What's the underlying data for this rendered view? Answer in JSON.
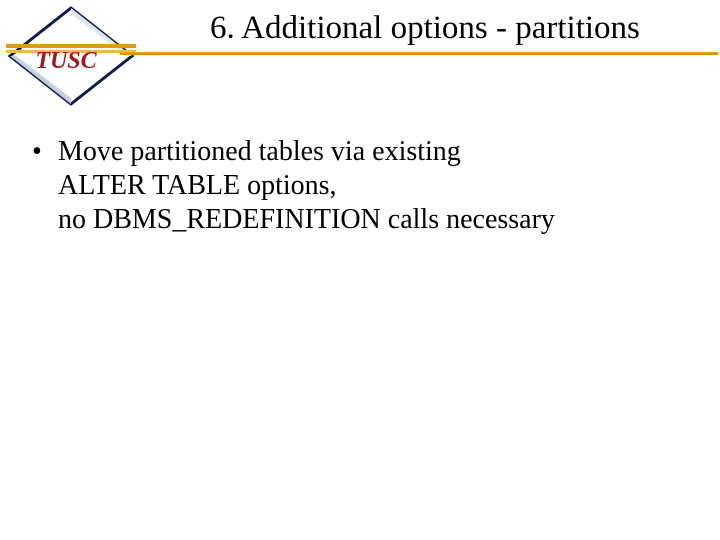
{
  "logo": {
    "text": "TUSC"
  },
  "title": "6.  Additional options - partitions",
  "bullets": [
    {
      "lines": [
        "Move partitioned tables via existing",
        "ALTER TABLE options,",
        "no DBMS_REDEFINITION calls necessary"
      ]
    }
  ],
  "colors": {
    "accent": "#e09a1a",
    "logo_navy": "#0f1a4a",
    "logo_red": "#a01820"
  }
}
